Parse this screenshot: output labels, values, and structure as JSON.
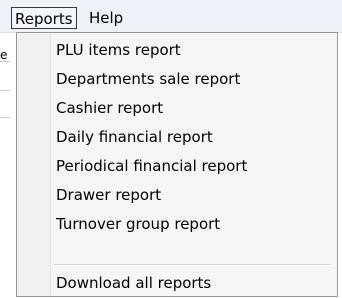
{
  "menubar": {
    "items": [
      {
        "label": "Reports"
      },
      {
        "label": "Help"
      }
    ]
  },
  "background": {
    "fragment_char": "e"
  },
  "dropdown": {
    "items": [
      {
        "label": "PLU items report"
      },
      {
        "label": "Departments sale report"
      },
      {
        "label": "Cashier report"
      },
      {
        "label": "Daily financial report"
      },
      {
        "label": "Periodical financial report"
      },
      {
        "label": "Drawer report"
      },
      {
        "label": "Turnover group report"
      }
    ],
    "footer_item": {
      "label": "Download all reports"
    }
  }
}
